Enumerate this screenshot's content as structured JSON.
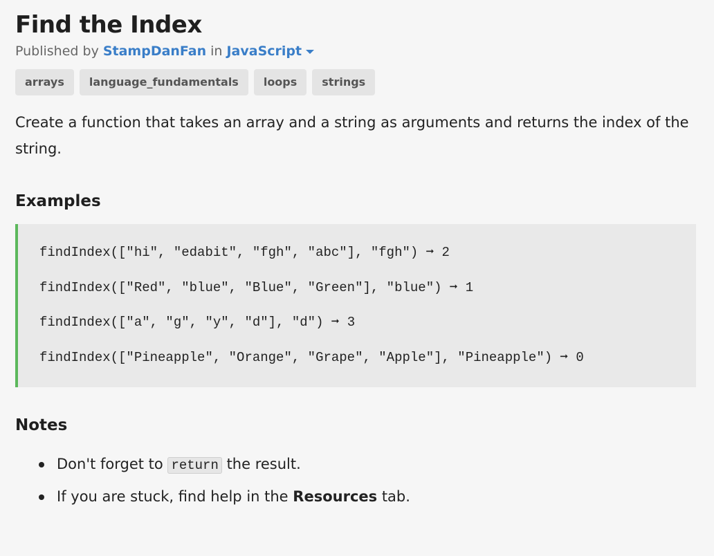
{
  "challenge": {
    "title": "Find the Index",
    "byline_prefix": "Published by",
    "author": "StampDanFan",
    "byline_in": "in",
    "language": "JavaScript"
  },
  "tags": [
    "arrays",
    "language_fundamentals",
    "loops",
    "strings"
  ],
  "description": "Create a function that takes an array and a string as arguments and returns the index of the string.",
  "examples": {
    "heading": "Examples",
    "lines": [
      "findIndex([\"hi\", \"edabit\", \"fgh\", \"abc\"], \"fgh\") ➞ 2",
      "findIndex([\"Red\", \"blue\", \"Blue\", \"Green\"], \"blue\") ➞ 1",
      "findIndex([\"a\", \"g\", \"y\", \"d\"], \"d\") ➞ 3",
      "findIndex([\"Pineapple\", \"Orange\", \"Grape\", \"Apple\"], \"Pineapple\") ➞ 0"
    ]
  },
  "notes": {
    "heading": "Notes",
    "note1": {
      "before": "Don't forget to",
      "code": "return",
      "after": "the result."
    },
    "note2": {
      "before": "If you are stuck, find help in the",
      "strong": "Resources",
      "after": "tab."
    }
  },
  "colors": {
    "link": "#3a7ec8",
    "code_border": "#5cb85c",
    "code_bg": "#e9e9e9",
    "tag_bg": "#e4e4e4",
    "page_bg": "#f6f6f6"
  },
  "icons": {
    "language_dropdown": "caret-down-icon"
  }
}
